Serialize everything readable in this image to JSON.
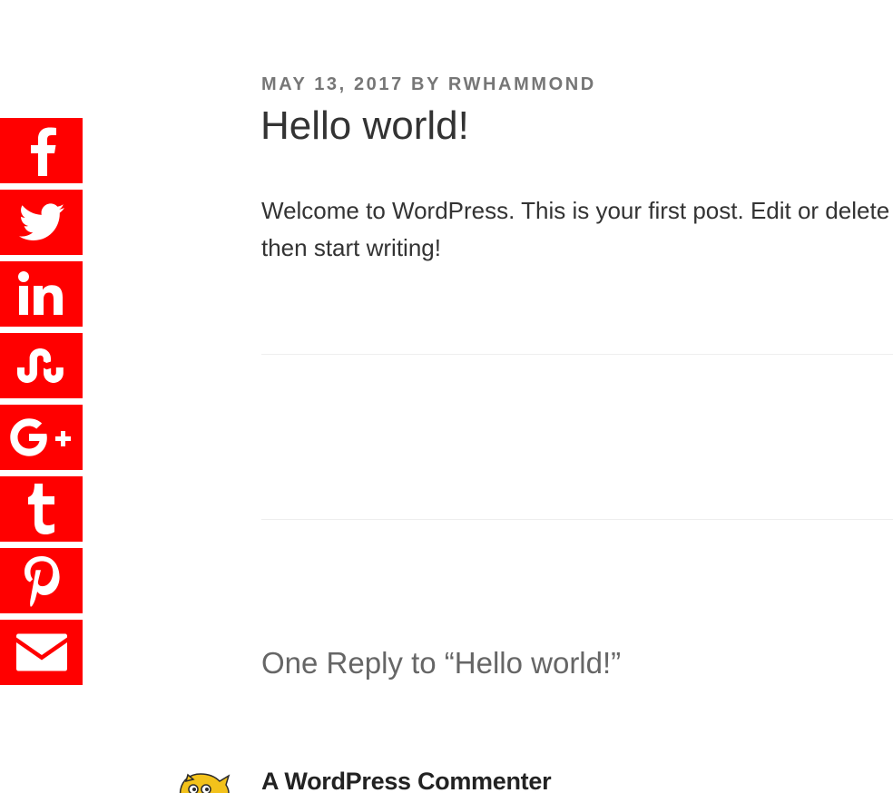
{
  "share_bar": {
    "color": "#ff0000",
    "buttons": [
      {
        "icon": "facebook-icon"
      },
      {
        "icon": "twitter-icon"
      },
      {
        "icon": "linkedin-icon"
      },
      {
        "icon": "stumbleupon-icon"
      },
      {
        "icon": "google-plus-icon"
      },
      {
        "icon": "tumblr-icon"
      },
      {
        "icon": "pinterest-icon"
      },
      {
        "icon": "email-icon"
      }
    ]
  },
  "post": {
    "date": "MAY 13, 2017",
    "by": "BY",
    "author": "RWHAMMOND",
    "title": "Hello world!",
    "body": "Welcome to WordPress. This is your first post. Edit or delete it, then start writing!"
  },
  "comments": {
    "title": "One Reply to “Hello world!”",
    "items": [
      {
        "author": "A WordPress Commenter",
        "avatar_icon": "wapuu-avatar-icon"
      }
    ]
  }
}
